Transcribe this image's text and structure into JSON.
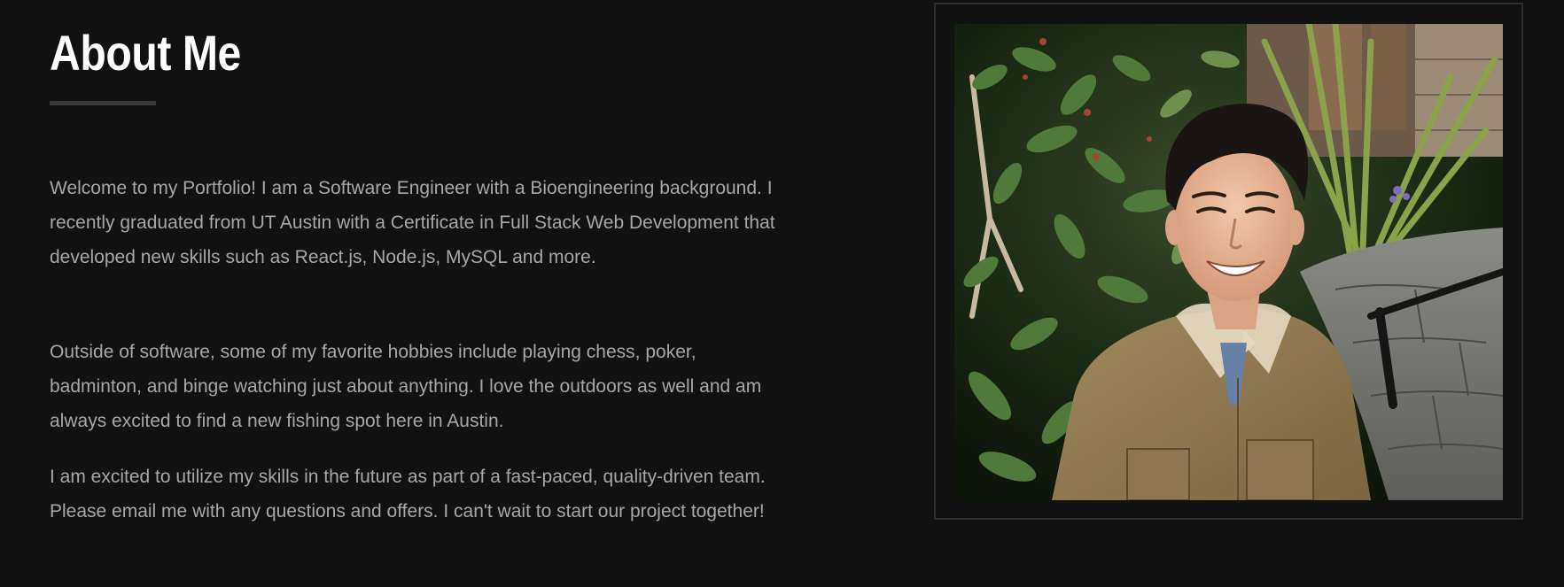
{
  "about": {
    "title": "About Me",
    "paragraphs": [
      "Welcome to my Portfolio! I am a Software Engineer with a Bioengineering background. I recently graduated from UT Austin with a Certificate in Full Stack Web Development that developed new skills such as React.js, Node.js, MySQL and more.",
      "Outside of software, some of my favorite hobbies include playing chess, poker, badminton, and binge watching just about anything. I love the outdoors as well and am always excited to find a new fishing spot here in Austin.",
      "I am excited to utilize my skills in the future as part of a fast-paced, quality-driven team. Please email me with any questions and offers. I can't wait to start our project together!"
    ]
  },
  "photo": {
    "subject": "portrait-photo"
  },
  "colors": {
    "background": "#111111",
    "title": "#ffffff",
    "body_text": "#a7a7a7",
    "accent_line": "#3a3a3a",
    "frame_border": "#2e2e2e"
  }
}
